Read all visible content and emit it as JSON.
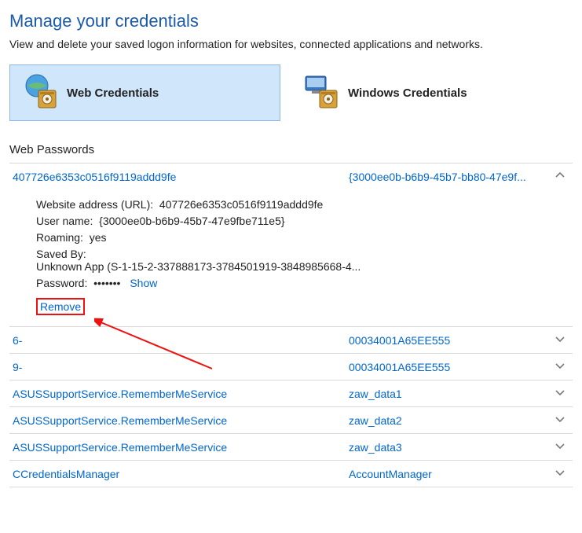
{
  "header": {
    "title": "Manage your credentials",
    "subtitle": "View and delete your saved logon information for websites, connected applications and networks."
  },
  "tabs": {
    "web": "Web Credentials",
    "windows": "Windows Credentials"
  },
  "section": {
    "title": "Web Passwords"
  },
  "expanded": {
    "site": "407726e6353c0516f9119addd9fe",
    "user_short": "{3000ee0b-b6b9-45b7-bb80-47e9f...",
    "url_label": "Website address (URL):",
    "url_value": "407726e6353c0516f9119addd9fe",
    "username_label": "User name:",
    "username_value": "{3000ee0b-b6b9-45b7-47e9fbe711e5}",
    "roaming_label": "Roaming:",
    "roaming_value": "yes",
    "savedby_label": "Saved By:",
    "savedby_value": "Unknown App (S-1-15-2-337888173-3784501919-3848985668-4...",
    "password_label": "Password:",
    "password_value": "•••••••",
    "show": "Show",
    "remove": "Remove"
  },
  "entries": [
    {
      "site": "6-",
      "user": "00034001A65EE555"
    },
    {
      "site": "9-",
      "user": "00034001A65EE555"
    },
    {
      "site": "ASUSSupportService.RememberMeService",
      "user": "zaw_data1"
    },
    {
      "site": "ASUSSupportService.RememberMeService",
      "user": "zaw_data2"
    },
    {
      "site": "ASUSSupportService.RememberMeService",
      "user": "zaw_data3"
    },
    {
      "site": "CCredentialsManager",
      "user": "AccountManager"
    }
  ]
}
